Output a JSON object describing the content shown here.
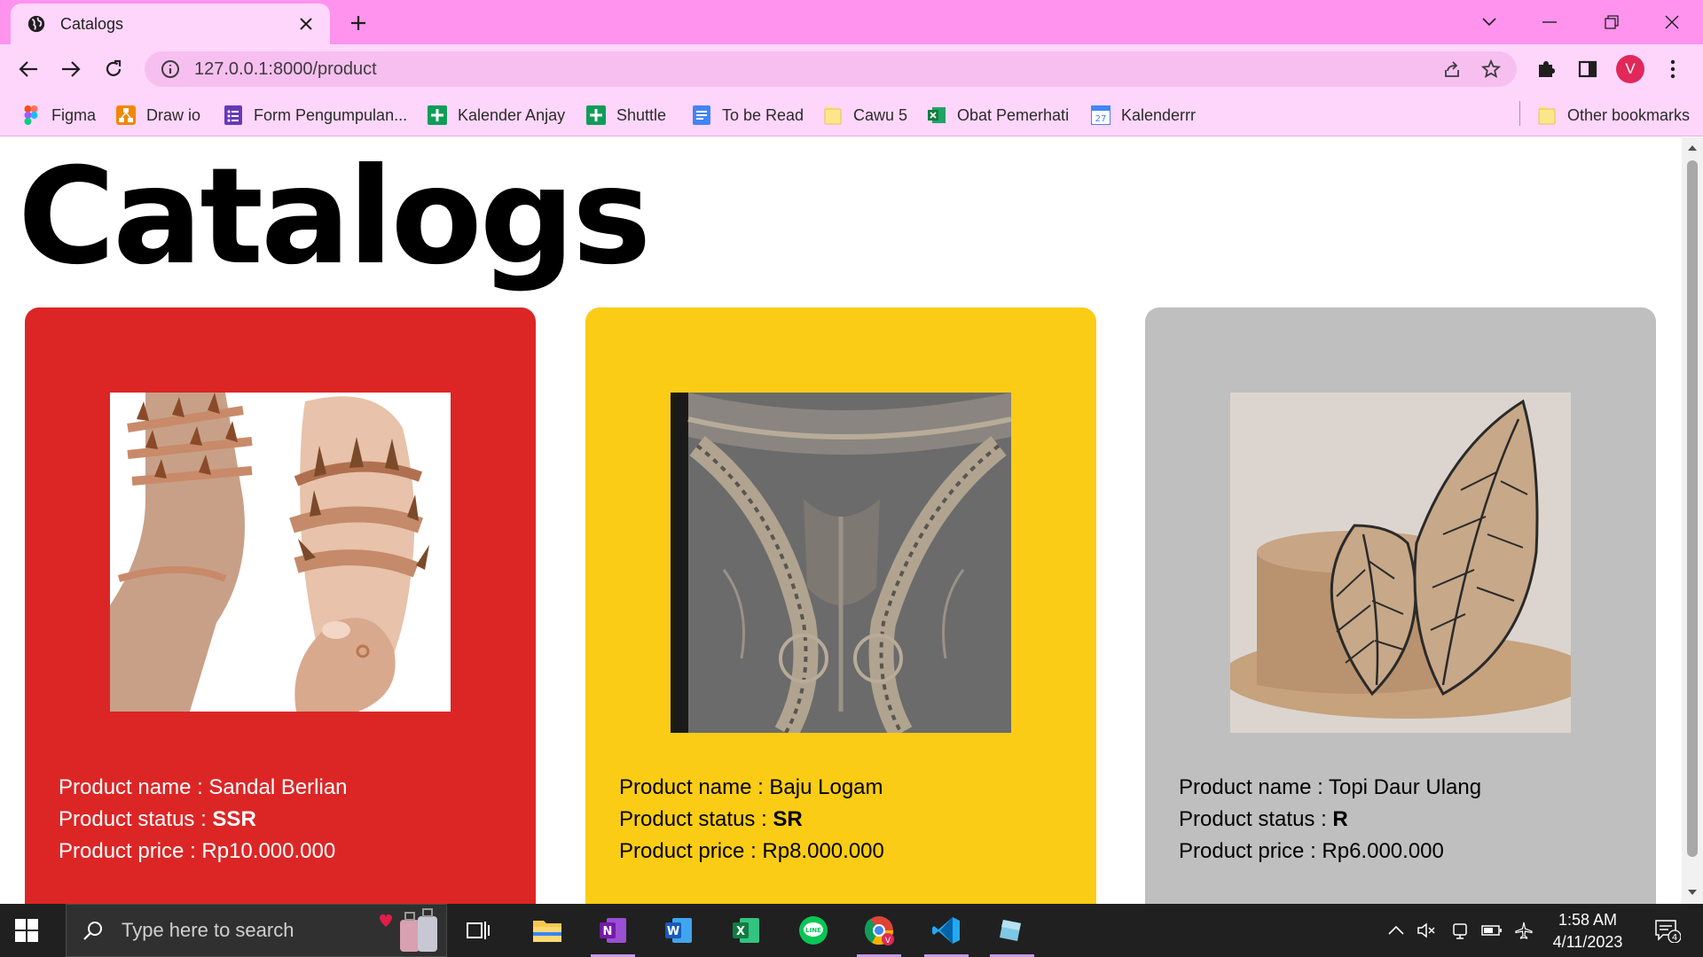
{
  "browser": {
    "tab_title": "Catalogs",
    "url": "127.0.0.1:8000/product",
    "profile_initial": "V",
    "bookmarks": [
      {
        "label": "Figma",
        "icon": "figma-icon"
      },
      {
        "label": "Draw io",
        "icon": "drawio-icon"
      },
      {
        "label": "Form Pengumpulan...",
        "icon": "forms-icon"
      },
      {
        "label": "Kalender Anjay",
        "icon": "sheets-icon"
      },
      {
        "label": "Shuttle",
        "icon": "sheets-icon"
      },
      {
        "label": "To be Read",
        "icon": "docs-icon"
      },
      {
        "label": "Cawu 5",
        "icon": "folder-icon"
      },
      {
        "label": "Obat Pemerhati",
        "icon": "excel-icon"
      },
      {
        "label": "Kalenderrr",
        "icon": "calendar-icon"
      }
    ],
    "other_bookmarks": "Other bookmarks"
  },
  "page": {
    "title": "Catalogs",
    "labels": {
      "name": "Product name : ",
      "status": "Product status : ",
      "price": "Product price : "
    },
    "products": [
      {
        "name": "Sandal Berlian",
        "status": "SSR",
        "price": "Rp10.000.000",
        "card_color": "#dc2626",
        "text_color": "#ffffff"
      },
      {
        "name": "Baju Logam",
        "status": "SR",
        "price": "Rp8.000.000",
        "card_color": "#facc15",
        "text_color": "#000000"
      },
      {
        "name": "Topi Daur Ulang",
        "status": "R",
        "price": "Rp6.000.000",
        "card_color": "#bfbfbf",
        "text_color": "#000000"
      }
    ]
  },
  "taskbar": {
    "search_placeholder": "Type here to search",
    "time": "1:58 AM",
    "date": "4/11/2023",
    "notification_count": "4"
  }
}
